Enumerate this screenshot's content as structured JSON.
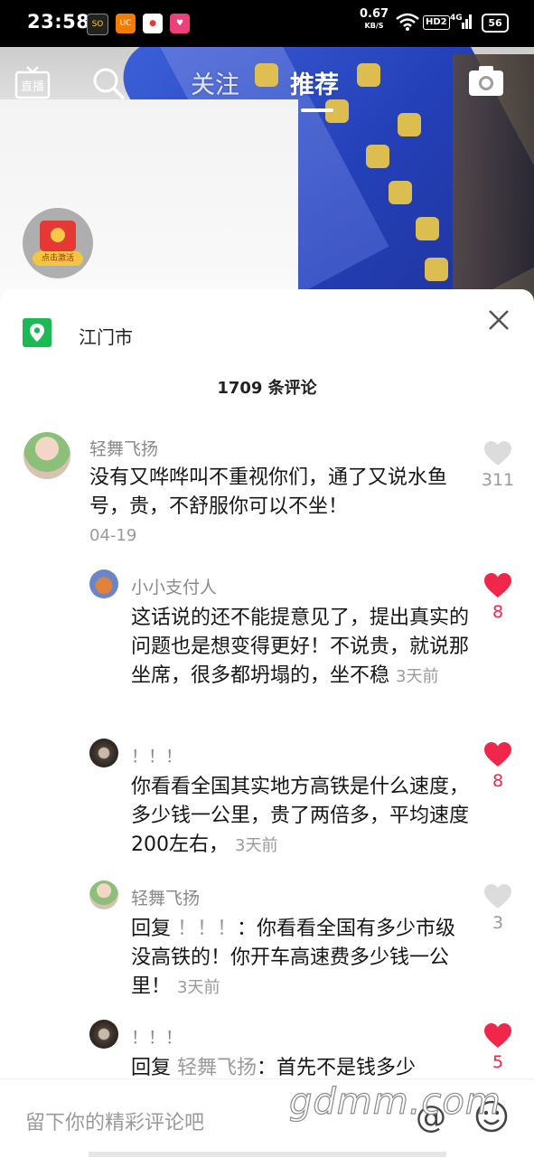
{
  "status_bar": {
    "time": "23:58",
    "net_speed_value": "0.67",
    "net_speed_unit": "KB/S",
    "hd_label": "HD2",
    "network": "4G",
    "battery": "56",
    "app_icons": [
      "so-app-icon",
      "uc-browser-icon",
      "map-pin-app-icon",
      "pink-app-icon"
    ]
  },
  "top_nav": {
    "live_label": "直播",
    "tabs": [
      {
        "label": "关注",
        "active": false
      },
      {
        "label": "推荐",
        "active": true
      }
    ]
  },
  "red_packet": {
    "label": "点击激活"
  },
  "comments_sheet": {
    "location": "江门市",
    "count_text": "1709 条评论",
    "comments": [
      {
        "user": "轻舞飞扬",
        "text": "没有又哗哗叫不重视你们，通了又说水鱼号，贵，不舒服你可以不坐！",
        "time": "04-19",
        "likes": "311",
        "liked": false
      },
      {
        "user": "小小支付人",
        "text": "这话说的还不能提意见了，提出真实的问题也是想变得更好！不说贵，就说那坐席，很多都坍塌的，坐不稳",
        "time": "3天前",
        "likes": "8",
        "liked": true
      },
      {
        "user": "！！！",
        "text": "你看看全国其实地方高铁是什么速度，多少钱一公里，贵了两倍多，平均速度200左右，",
        "time": "3天前",
        "likes": "8",
        "liked": true
      },
      {
        "user": "轻舞飞扬",
        "reply_prefix": "回复 ",
        "reply_to": "！！！",
        "text": "：你看看全国有多少市级没高铁的！你开车高速费多少钱一公里！",
        "time": "3天前",
        "likes": "3",
        "liked": false
      },
      {
        "user": "！！！",
        "reply_prefix": "回复 ",
        "reply_to": "轻舞飞扬",
        "text": "：首先不是钱多少",
        "likes": "5",
        "liked": true
      }
    ]
  },
  "input_bar": {
    "placeholder": "留下你的精彩评论吧",
    "at_symbol": "@"
  },
  "watermark": "gdmm.com",
  "colors": {
    "like_red": "#f0264b",
    "location_green": "#1db954",
    "muted_gray": "#9a9a9a"
  }
}
